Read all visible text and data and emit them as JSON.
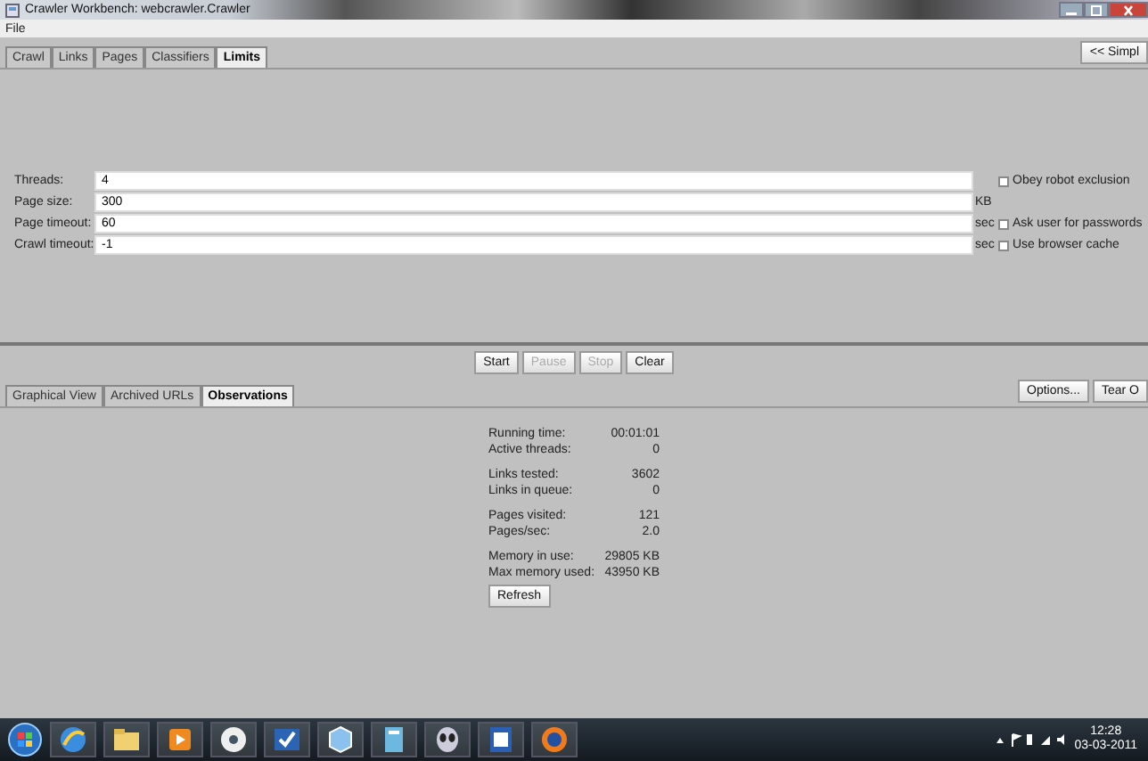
{
  "window": {
    "title": "Crawler Workbench: webcrawler.Crawler"
  },
  "menu": [
    "File"
  ],
  "tabs": [
    {
      "label": "Crawl",
      "selected": false
    },
    {
      "label": "Links",
      "selected": false
    },
    {
      "label": "Pages",
      "selected": false
    },
    {
      "label": "Classifiers",
      "selected": false
    },
    {
      "label": "Limits",
      "selected": true
    }
  ],
  "simple_button": "<< Simpl",
  "limits": [
    {
      "label": "Threads:",
      "value": "4",
      "option": {
        "label": "Obey robot exclusion",
        "checked": false
      }
    },
    {
      "label": "Page size:",
      "value": "300",
      "unit": "KB"
    },
    {
      "label": "Page timeout:",
      "value": "60",
      "unit": "sec",
      "option": {
        "label": "Ask user for passwords",
        "checked": false
      }
    },
    {
      "label": "Crawl timeout:",
      "value": "-1",
      "unit": "sec",
      "option": {
        "label": "Use browser cache",
        "checked": false
      }
    }
  ],
  "controls": [
    {
      "label": "Start",
      "disabled": false
    },
    {
      "label": "Pause",
      "disabled": true
    },
    {
      "label": "Stop",
      "disabled": true
    },
    {
      "label": "Clear",
      "disabled": false
    }
  ],
  "view_tabs": [
    {
      "label": "Graphical View",
      "selected": false
    },
    {
      "label": "Archived URLs",
      "selected": false
    },
    {
      "label": "Observations",
      "selected": true
    }
  ],
  "view_buttons": [
    "Options...",
    "Tear O"
  ],
  "observations": [
    [
      {
        "label": "Running time:",
        "value": "00:01:01"
      },
      {
        "label": "Active threads:",
        "value": "0"
      }
    ],
    [
      {
        "label": "Links tested:",
        "value": "3602"
      },
      {
        "label": "Links in queue:",
        "value": "0"
      }
    ],
    [
      {
        "label": "Pages visited:",
        "value": "121"
      },
      {
        "label": "Pages/sec:",
        "value": "2.0"
      }
    ],
    [
      {
        "label": "Memory in use:",
        "value": "29805 KB"
      },
      {
        "label": "Max memory used:",
        "value": "43950 KB"
      }
    ]
  ],
  "refresh_button": "Refresh",
  "taskbar": {
    "time": "12:28",
    "date": "03-03-2011"
  }
}
